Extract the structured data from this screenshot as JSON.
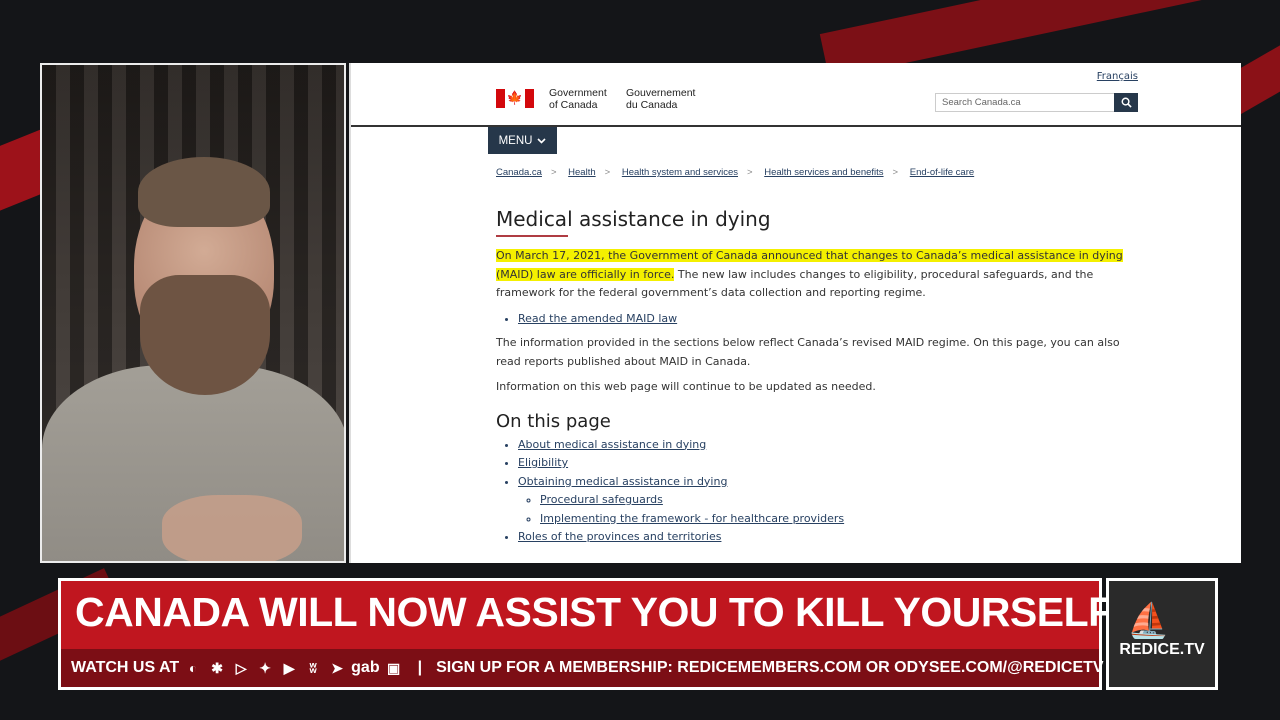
{
  "browser": {
    "language_link": "Français",
    "gov_en_line1": "Government",
    "gov_en_line2": "of Canada",
    "gov_fr_line1": "Gouvernement",
    "gov_fr_line2": "du Canada",
    "search_placeholder": "Search Canada.ca",
    "menu_label": "MENU",
    "breadcrumbs": [
      "Canada.ca",
      "Health",
      "Health system and services",
      "Health services and benefits",
      "End-of-life care"
    ],
    "page_title": "Medical assistance in dying",
    "intro_highlight": "On March 17, 2021, the Government of Canada announced that changes to Canada’s medical assistance in dying (MAID) law are officially in force.",
    "intro_rest": " The new law includes changes to eligibility, procedural safeguards, and the framework for the federal government’s data collection and reporting regime.",
    "read_law_link": "Read the amended MAID law",
    "para2": "The information provided in the sections below reflect Canada’s revised MAID regime. On this page, you can also read reports published about MAID in Canada.",
    "para3": "Information on this web page will continue to be updated as needed.",
    "on_this_page_heading": "On this page",
    "toc": [
      "About medical assistance in dying",
      "Eligibility",
      "Obtaining medical assistance in dying",
      "Roles of the provinces and territories"
    ],
    "toc_sub": [
      "Procedural safeguards",
      "Implementing the framework - for healthcare providers"
    ],
    "flag_color": "#d3080c",
    "highlight_color": "#f4f000"
  },
  "banner": {
    "title": "CANADA WILL NOW ASSIST YOU TO KILL YOURSELF",
    "watch_label": "WATCH US AT",
    "membership_text": "SIGN UP FOR A MEMBERSHIP: REDICEMEMBERS.COM OR ODYSEE.COM/@REDICETV",
    "gab_label": "gab",
    "red_color": "#c0161f"
  },
  "logo": {
    "text": "REDICE.TV"
  }
}
